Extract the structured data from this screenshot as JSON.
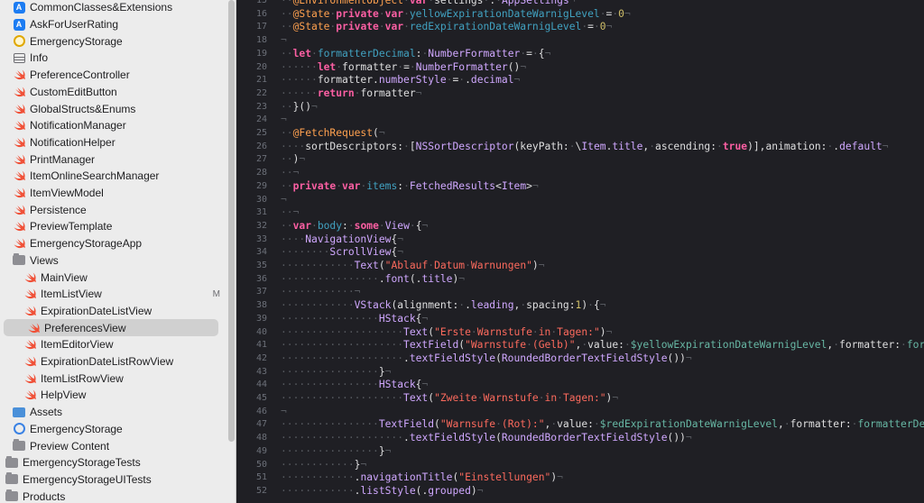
{
  "navigator": {
    "items": [
      {
        "label": "CommonClasses&Extensions",
        "icon": "app-store-icon",
        "indent": 1,
        "disclosure": "",
        "badge": ""
      },
      {
        "label": "AskForUserRating",
        "icon": "app-store-icon",
        "indent": 1,
        "disclosure": "",
        "badge": ""
      },
      {
        "label": "EmergencyStorage",
        "icon": "gear-badge-icon",
        "indent": 1,
        "disclosure": "",
        "badge": ""
      },
      {
        "label": "Info",
        "icon": "plist-icon",
        "indent": 1,
        "disclosure": "",
        "badge": ""
      },
      {
        "label": "PreferenceController",
        "icon": "swift-icon",
        "indent": 1,
        "disclosure": "",
        "badge": ""
      },
      {
        "label": "CustomEditButton",
        "icon": "swift-icon",
        "indent": 1,
        "disclosure": "",
        "badge": ""
      },
      {
        "label": "GlobalStructs&Enums",
        "icon": "swift-icon",
        "indent": 1,
        "disclosure": "",
        "badge": ""
      },
      {
        "label": "NotificationManager",
        "icon": "swift-icon",
        "indent": 1,
        "disclosure": "",
        "badge": ""
      },
      {
        "label": "NotificationHelper",
        "icon": "swift-icon",
        "indent": 1,
        "disclosure": "",
        "badge": ""
      },
      {
        "label": "PrintManager",
        "icon": "swift-icon",
        "indent": 1,
        "disclosure": "",
        "badge": ""
      },
      {
        "label": "ItemOnlineSearchManager",
        "icon": "swift-icon",
        "indent": 1,
        "disclosure": "",
        "badge": ""
      },
      {
        "label": "ItemViewModel",
        "icon": "swift-icon",
        "indent": 1,
        "disclosure": "",
        "badge": ""
      },
      {
        "label": "Persistence",
        "icon": "swift-icon",
        "indent": 1,
        "disclosure": "",
        "badge": ""
      },
      {
        "label": "PreviewTemplate",
        "icon": "swift-icon",
        "indent": 1,
        "disclosure": "",
        "badge": ""
      },
      {
        "label": "EmergencyStorageApp",
        "icon": "swift-icon",
        "indent": 1,
        "disclosure": "",
        "badge": ""
      },
      {
        "label": "Views",
        "icon": "folder-icon",
        "indent": 0,
        "disclosure": "⌄",
        "badge": ""
      },
      {
        "label": "MainView",
        "icon": "swift-icon",
        "indent": 2,
        "disclosure": "",
        "badge": ""
      },
      {
        "label": "ItemListView",
        "icon": "swift-icon",
        "indent": 2,
        "disclosure": "",
        "badge": "M"
      },
      {
        "label": "ExpirationDateListView",
        "icon": "swift-icon",
        "indent": 2,
        "disclosure": "",
        "badge": ""
      },
      {
        "label": "PreferencesView",
        "icon": "swift-icon",
        "indent": 2,
        "disclosure": "",
        "badge": "",
        "selected": true
      },
      {
        "label": "ItemEditorView",
        "icon": "swift-icon",
        "indent": 2,
        "disclosure": "",
        "badge": ""
      },
      {
        "label": "ExpirationDateListRowView",
        "icon": "swift-icon",
        "indent": 2,
        "disclosure": "",
        "badge": ""
      },
      {
        "label": "ItemListRowView",
        "icon": "swift-icon",
        "indent": 2,
        "disclosure": "",
        "badge": ""
      },
      {
        "label": "HelpView",
        "icon": "swift-icon",
        "indent": 2,
        "disclosure": "",
        "badge": ""
      },
      {
        "label": "Assets",
        "icon": "assets-icon",
        "indent": 1,
        "disclosure": "",
        "badge": ""
      },
      {
        "label": "EmergencyStorage",
        "icon": "core-data-icon",
        "indent": 1,
        "disclosure": "",
        "badge": ""
      },
      {
        "label": "Preview Content",
        "icon": "folder-icon",
        "indent": 0,
        "disclosure": "›",
        "badge": ""
      },
      {
        "label": "EmergencyStorageTests",
        "icon": "folder-icon",
        "indent": -1,
        "disclosure": "",
        "badge": ""
      },
      {
        "label": "EmergencyStorageUITests",
        "icon": "folder-icon",
        "indent": -1,
        "disclosure": "",
        "badge": ""
      },
      {
        "label": "Products",
        "icon": "folder-icon",
        "indent": -1,
        "disclosure": "",
        "badge": ""
      }
    ]
  },
  "editor": {
    "lines": [
      {
        "n": "15",
        "html": "<span class='ws'>··</span><span class='at'>@EnvironmentObject</span><span class='ws'>·</span><span class='kw'>var</span><span class='ws'>·</span>settings<span class='ws'>·</span>:<span class='ws'>·</span><span class='ty'>AppSettings</span><span class='ws'>¬</span>"
      },
      {
        "n": "16",
        "html": "<span class='ws'>··</span><span class='at'>@State</span><span class='ws'>·</span><span class='kw'>private</span><span class='ws'>·</span><span class='kw'>var</span><span class='ws'>·</span><span class='pr'>yellowExpirationDateWarnigLevel</span><span class='ws'>·</span>=<span class='ws'>·</span><span class='num'>0</span><span class='ws'>¬</span>"
      },
      {
        "n": "17",
        "html": "<span class='ws'>··</span><span class='at'>@State</span><span class='ws'>·</span><span class='kw'>private</span><span class='ws'>·</span><span class='kw'>var</span><span class='ws'>·</span><span class='pr'>redExpirationDateWarnigLevel</span><span class='ws'>·</span>=<span class='ws'>·</span><span class='num'>0</span><span class='ws'>¬</span>"
      },
      {
        "n": "18",
        "html": "<span class='ws'>¬</span>"
      },
      {
        "n": "19",
        "html": "<span class='ws'>··</span><span class='kw'>let</span><span class='ws'>·</span><span class='pr'>formatterDecimal</span>:<span class='ws'>·</span><span class='ty'>NumberFormatter</span><span class='ws'>·</span>=<span class='ws'>·</span>{<span class='ws'>¬</span>"
      },
      {
        "n": "20",
        "html": "<span class='ws'>······</span><span class='kw'>let</span><span class='ws'>·</span>formatter<span class='ws'>·</span>=<span class='ws'>·</span><span class='ty'>NumberFormatter</span>()<span class='ws'>¬</span>"
      },
      {
        "n": "21",
        "html": "<span class='ws'>······</span>formatter.<span class='ty'>numberStyle</span><span class='ws'>·</span>=<span class='ws'>·</span>.<span class='ty'>decimal</span><span class='ws'>¬</span>"
      },
      {
        "n": "22",
        "html": "<span class='ws'>······</span><span class='kw'>return</span><span class='ws'>·</span>formatter<span class='ws'>¬</span>"
      },
      {
        "n": "23",
        "html": "<span class='ws'>··</span>}()<span class='ws'>¬</span>"
      },
      {
        "n": "24",
        "html": "<span class='ws'>¬</span>"
      },
      {
        "n": "25",
        "html": "<span class='ws'>··</span><span class='at'>@FetchRequest</span>(<span class='ws'>¬</span>"
      },
      {
        "n": "26",
        "html": "<span class='ws'>····</span>sortDescriptors:<span class='ws'>·</span>[<span class='ty'>NSSortDescriptor</span>(keyPath:<span class='ws'>·</span>\\<span class='ty'>Item</span>.<span class='ty'>title</span>,<span class='ws'>·</span>ascending:<span class='ws'>·</span><span class='kw'>true</span>)],animation:<span class='ws'>·</span>.<span class='ty'>default</span><span class='ws'>¬</span>"
      },
      {
        "n": "27",
        "html": "<span class='ws'>··</span>)<span class='ws'>¬</span>"
      },
      {
        "n": "28",
        "html": "<span class='ws'>··¬</span>"
      },
      {
        "n": "29",
        "html": "<span class='ws'>··</span><span class='kw'>private</span><span class='ws'>·</span><span class='kw'>var</span><span class='ws'>·</span><span class='pr'>items</span>:<span class='ws'>·</span><span class='ty'>FetchedResults</span>&lt;<span class='ty'>Item</span>&gt;<span class='ws'>¬</span>"
      },
      {
        "n": "30",
        "html": "<span class='ws'>¬</span>"
      },
      {
        "n": "31",
        "html": "<span class='ws'>··¬</span>"
      },
      {
        "n": "32",
        "html": "<span class='ws'>··</span><span class='kw'>var</span><span class='ws'>·</span><span class='pr'>body</span>:<span class='ws'>·</span><span class='kw'>some</span><span class='ws'>·</span><span class='ty'>View</span><span class='ws'>·</span>{<span class='ws'>¬</span>"
      },
      {
        "n": "33",
        "html": "<span class='ws'>····</span><span class='ty'>NavigationView</span>{<span class='ws'>¬</span>"
      },
      {
        "n": "34",
        "html": "<span class='ws'>········</span><span class='ty'>ScrollView</span>{<span class='ws'>¬</span>"
      },
      {
        "n": "35",
        "html": "<span class='ws'>············</span><span class='ty'>Text</span>(<span class='str'>\"Ablauf<span class='ws'>·</span>Datum<span class='ws'>·</span>Warnungen\"</span>)<span class='ws'>¬</span>"
      },
      {
        "n": "36",
        "html": "<span class='ws'>················</span>.<span class='ty'>font</span>(.<span class='ty'>title</span>)<span class='ws'>¬</span>"
      },
      {
        "n": "37",
        "html": "<span class='ws'>············¬</span>"
      },
      {
        "n": "38",
        "html": "<span class='ws'>············</span><span class='ty'>VStack</span>(alignment:<span class='ws'>·</span>.<span class='ty'>leading</span>,<span class='ws'>·</span>spacing:<span class='num'>1</span>)<span class='ws'>·</span>{<span class='ws'>¬</span>"
      },
      {
        "n": "39",
        "html": "<span class='ws'>················</span><span class='ty'>HStack</span>{<span class='ws'>¬</span>"
      },
      {
        "n": "40",
        "html": "<span class='ws'>····················</span><span class='ty'>Text</span>(<span class='str'>\"Erste<span class='ws'>·</span>Warnstufe<span class='ws'>·</span>in<span class='ws'>·</span>Tagen:\"</span>)<span class='ws'>¬</span>"
      },
      {
        "n": "41",
        "html": "<span class='ws'>····················</span><span class='ty'>TextField</span>(<span class='str'>\"Warnstufe<span class='ws'>·</span>(Gelb)\"</span>,<span class='ws'>·</span>value:<span class='ws'>·</span><span class='fn'>$yellowExpirationDateWarnigLevel</span>,<span class='ws'>·</span>formatter:<span class='ws'>·</span><span class='fn'>formatterDecimal</span>)"
      },
      {
        "n": "42",
        "html": "<span class='ws'>····················</span>.<span class='ty'>textFieldStyle</span>(<span class='ty'>RoundedBorderTextFieldStyle</span>())<span class='ws'>¬</span>"
      },
      {
        "n": "43",
        "html": "<span class='ws'>················</span>}<span class='ws'>¬</span>"
      },
      {
        "n": "44",
        "html": "<span class='ws'>················</span><span class='ty'>HStack</span>{<span class='ws'>¬</span>"
      },
      {
        "n": "45",
        "html": "<span class='ws'>····················</span><span class='ty'>Text</span>(<span class='str'>\"Zweite<span class='ws'>·</span>Warnstufe<span class='ws'>·</span>in<span class='ws'>·</span>Tagen:\"</span>)<span class='ws'>¬</span>"
      },
      {
        "n": "46",
        "html": "<span class='ws'>¬</span>"
      },
      {
        "n": "47",
        "html": "<span class='ws'>················</span><span class='ty'>TextField</span>(<span class='str'>\"Warnsufe<span class='ws'>·</span>(Rot):\"</span>,<span class='ws'>·</span>value:<span class='ws'>·</span><span class='fn'>$redExpirationDateWarnigLevel</span>,<span class='ws'>·</span>formatter:<span class='ws'>·</span><span class='fn'>formatterDecimal</span>)"
      },
      {
        "n": "48",
        "html": "<span class='ws'>····················</span>.<span class='ty'>textFieldStyle</span>(<span class='ty'>RoundedBorderTextFieldStyle</span>())<span class='ws'>¬</span>"
      },
      {
        "n": "49",
        "html": "<span class='ws'>················</span>}<span class='ws'>¬</span>"
      },
      {
        "n": "50",
        "html": "<span class='ws'>············</span>}<span class='ws'>¬</span>"
      },
      {
        "n": "51",
        "html": "<span class='ws'>············</span>.<span class='ty'>navigationTitle</span>(<span class='str'>\"Einstellungen\"</span>)<span class='ws'>¬</span>"
      },
      {
        "n": "52",
        "html": "<span class='ws'>············</span>.<span class='ty'>listStyle</span>(.<span class='ty'>grouped</span>)<span class='ws'>¬</span>"
      }
    ]
  },
  "colors": {
    "editor_bg": "#1f1f24",
    "sidebar_bg": "#ececec",
    "keyword": "#fc5fa3",
    "string": "#fc6a5d",
    "type": "#d0a8ff",
    "number": "#d0bf69",
    "attribute": "#ffa14f",
    "swift_icon": "#f05138"
  }
}
